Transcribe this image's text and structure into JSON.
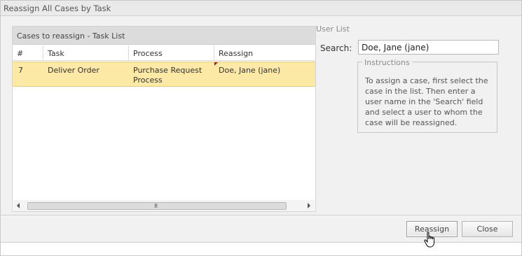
{
  "dialog": {
    "title": "Reassign All Cases by Task"
  },
  "task_list": {
    "title": "Cases to reassign - Task List",
    "columns": [
      "#",
      "Task",
      "Process",
      "Reassign"
    ],
    "rows": [
      {
        "num": "7",
        "task": "Deliver Order",
        "process_line1": "Purchase Request",
        "process_line2": "Process",
        "reassign": "Doe, Jane (jane)"
      }
    ],
    "scrollbar_grip": "III"
  },
  "user_list": {
    "label": "User List",
    "search_label": "Search:",
    "search_value": "Doe, Jane (jane)"
  },
  "instructions": {
    "legend": "Instructions",
    "text": "To assign a case, first select the case in the list. Then enter a user name in the 'Search' field and select a user to whom the case will be reassigned."
  },
  "buttons": {
    "reassign": "Reassign",
    "close": "Close"
  },
  "colors": {
    "selected_row": "#fce9a5",
    "dirty_marker": "#a3222a"
  }
}
